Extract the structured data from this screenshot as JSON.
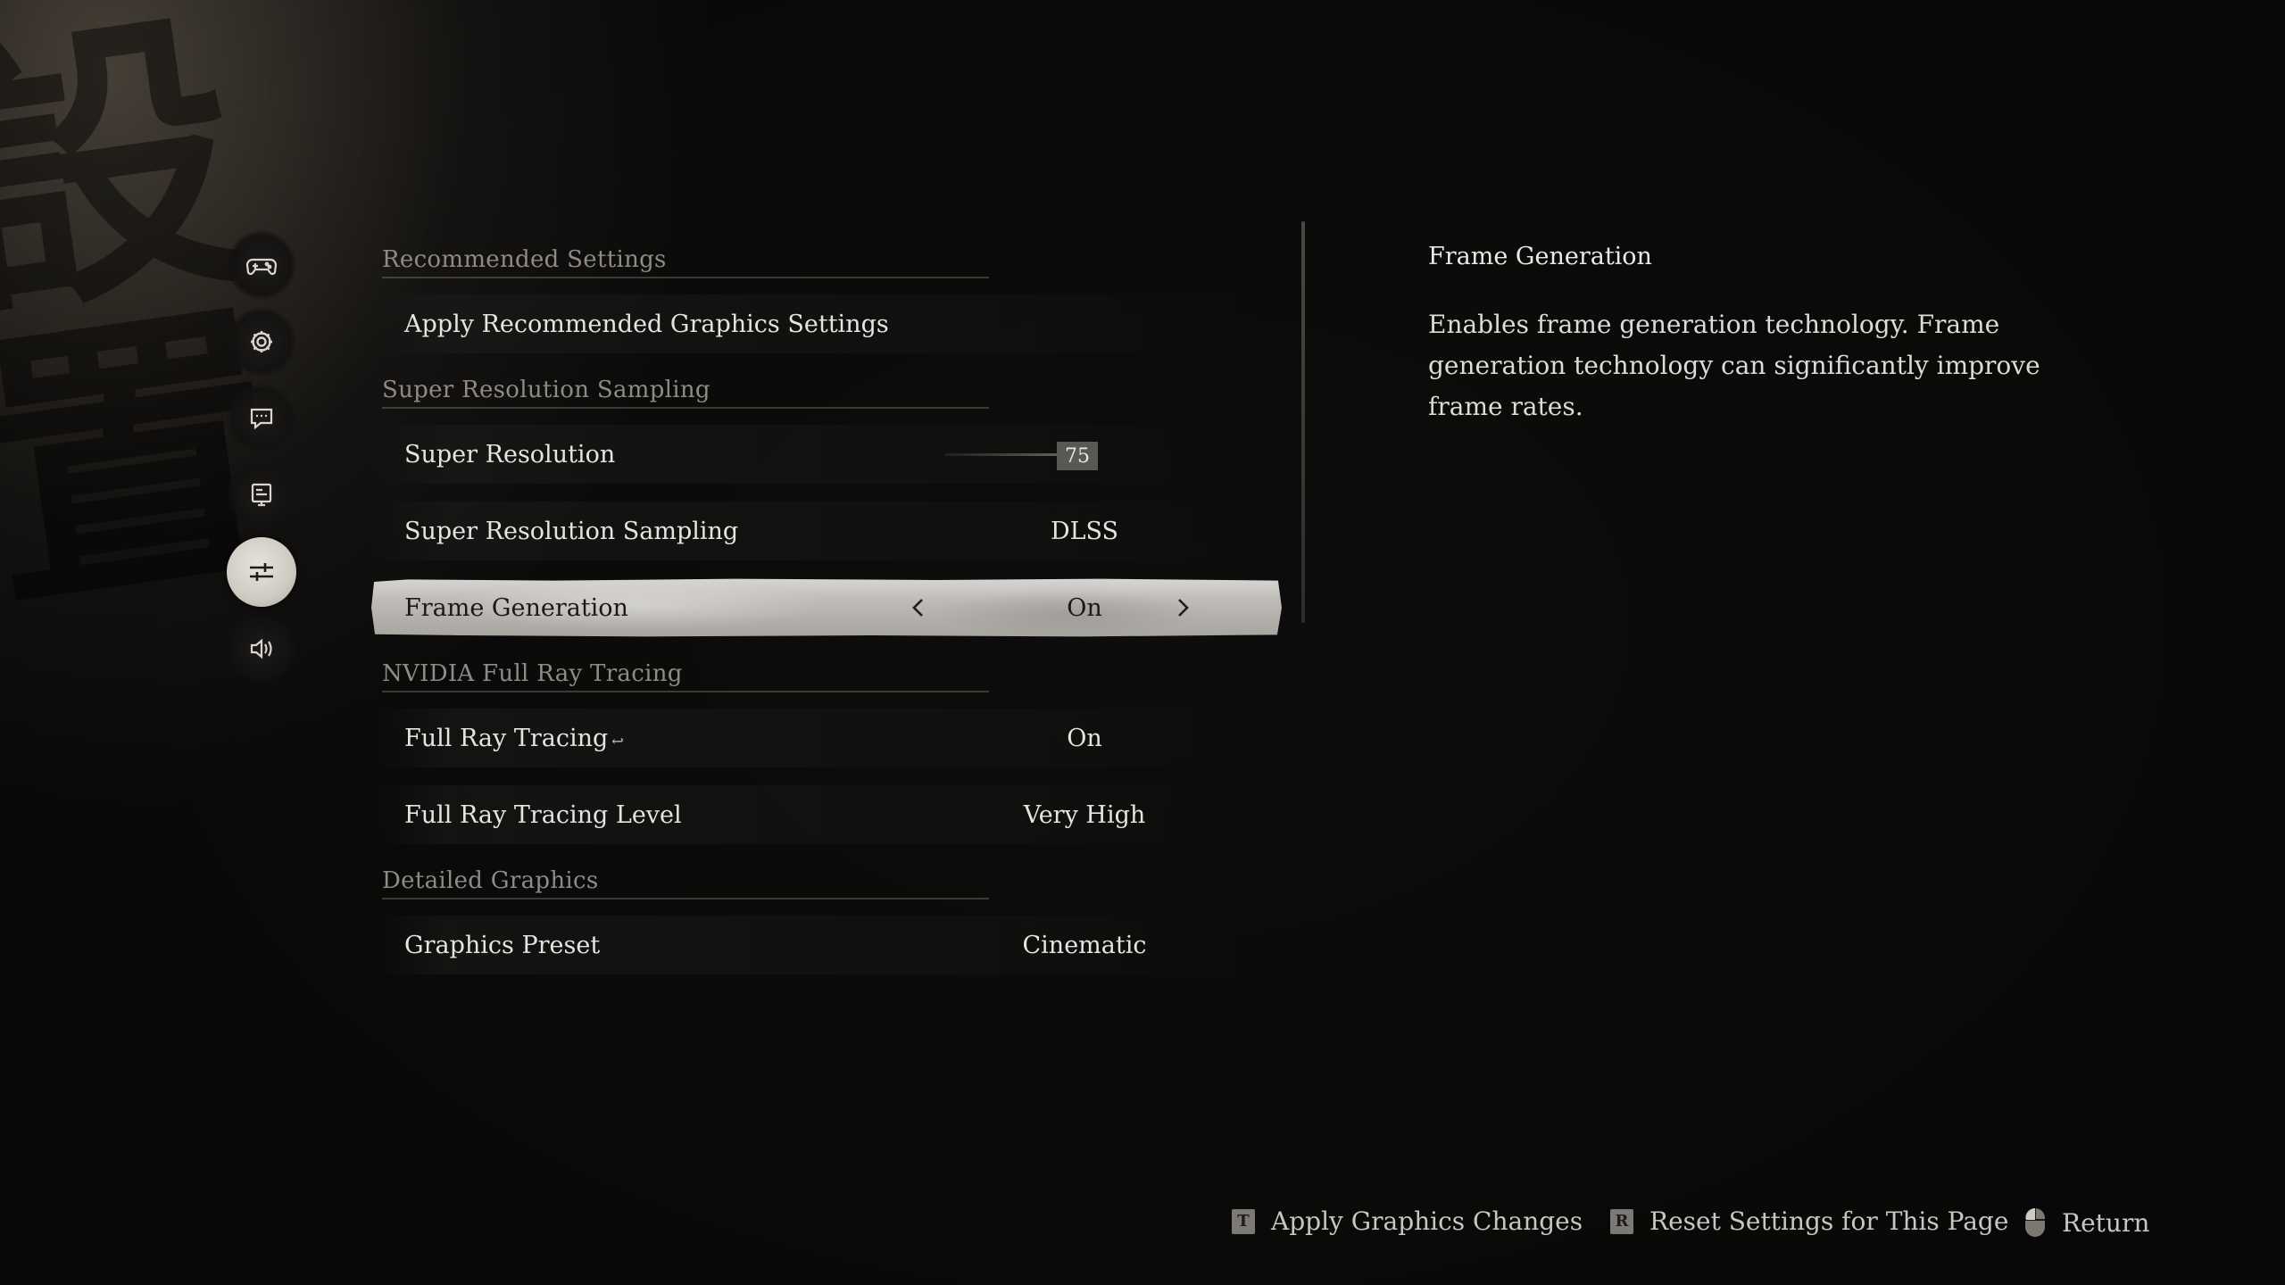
{
  "nav": {
    "items": [
      {
        "icon": "gamepad-icon",
        "active": false
      },
      {
        "icon": "gear-icon",
        "active": false
      },
      {
        "icon": "chat-icon",
        "active": false
      },
      {
        "icon": "display-icon",
        "active": false
      },
      {
        "icon": "sliders-icon",
        "active": true
      },
      {
        "icon": "speaker-icon",
        "active": false
      }
    ]
  },
  "settings": {
    "sections": {
      "recommended": "Recommended Settings",
      "super_resolution": "Super Resolution Sampling",
      "ray_tracing": "NVIDIA Full Ray Tracing",
      "detailed": "Detailed Graphics"
    },
    "rows": {
      "apply_recommended": {
        "label": "Apply Recommended Graphics Settings"
      },
      "super_resolution": {
        "label": "Super Resolution",
        "value": "75",
        "level": 75
      },
      "sr_sampling": {
        "label": "Super Resolution Sampling",
        "value": "DLSS"
      },
      "frame_generation": {
        "label": "Frame Generation",
        "value": "On"
      },
      "full_ray_tracing": {
        "label": "Full Ray Tracing",
        "mark": "↩",
        "value": "On"
      },
      "ray_tracing_level": {
        "label": "Full Ray Tracing Level",
        "value": "Very High"
      },
      "graphics_preset": {
        "label": "Graphics Preset",
        "value": "Cinematic"
      }
    }
  },
  "description": {
    "title": "Frame Generation",
    "body": "Enables frame generation technology. Frame generation technology can significantly improve frame rates."
  },
  "footer": {
    "apply": {
      "key": "T",
      "label": "Apply Graphics Changes"
    },
    "reset": {
      "key": "R",
      "label": "Reset Settings for This Page"
    },
    "return": {
      "icon": "mouse-icon",
      "label": "Return"
    }
  },
  "colors": {
    "highlight": "#c9c6c1",
    "text": "#e6e4df",
    "section": "#8e8b86"
  }
}
